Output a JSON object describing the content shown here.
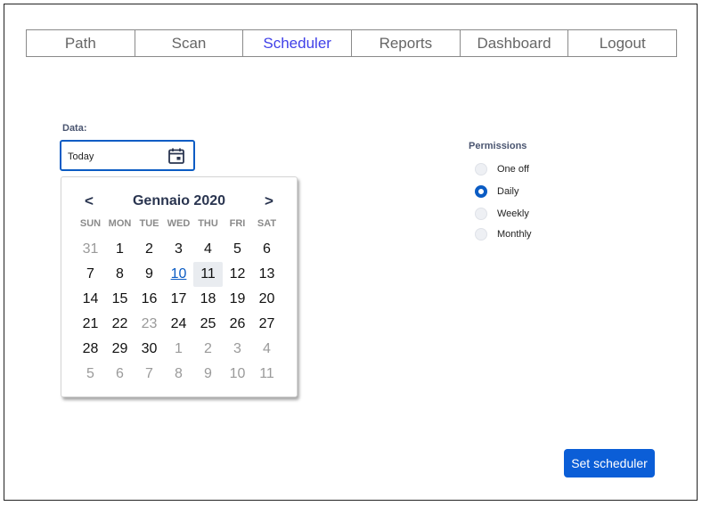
{
  "nav": {
    "items": [
      "Path",
      "Scan",
      "Scheduler",
      "Reports",
      "Dashboard",
      "Logout"
    ],
    "active": "Scheduler"
  },
  "date_field": {
    "label": "Data:",
    "value": "Today",
    "icon": "calendar-icon"
  },
  "calendar": {
    "prev": "<",
    "next": ">",
    "month_title": "Gennaio 2020",
    "weekdays": [
      "SUN",
      "MON",
      "TUE",
      "WED",
      "THU",
      "FRI",
      "SAT"
    ],
    "days": [
      {
        "d": "31",
        "m": true
      },
      {
        "d": "1"
      },
      {
        "d": "2"
      },
      {
        "d": "3"
      },
      {
        "d": "4"
      },
      {
        "d": "5"
      },
      {
        "d": "6"
      },
      {
        "d": "7"
      },
      {
        "d": "8"
      },
      {
        "d": "9"
      },
      {
        "d": "10",
        "today": true
      },
      {
        "d": "11",
        "sel": true
      },
      {
        "d": "12"
      },
      {
        "d": "13"
      },
      {
        "d": "14"
      },
      {
        "d": "15"
      },
      {
        "d": "16"
      },
      {
        "d": "17"
      },
      {
        "d": "18"
      },
      {
        "d": "19"
      },
      {
        "d": "20"
      },
      {
        "d": "21"
      },
      {
        "d": "22"
      },
      {
        "d": "23",
        "m": true
      },
      {
        "d": "24"
      },
      {
        "d": "25"
      },
      {
        "d": "26"
      },
      {
        "d": "27"
      },
      {
        "d": "28"
      },
      {
        "d": "29"
      },
      {
        "d": "30"
      },
      {
        "d": "1",
        "m": true
      },
      {
        "d": "2",
        "m": true
      },
      {
        "d": "3",
        "m": true
      },
      {
        "d": "4",
        "m": true
      },
      {
        "d": "5",
        "m": true
      },
      {
        "d": "6",
        "m": true
      },
      {
        "d": "7",
        "m": true
      },
      {
        "d": "8",
        "m": true
      },
      {
        "d": "9",
        "m": true
      },
      {
        "d": "10",
        "m": true
      },
      {
        "d": "11",
        "m": true
      }
    ]
  },
  "permissions": {
    "label": "Permissions",
    "options": [
      "One off",
      "Daily",
      "Weekly",
      "Monthly"
    ],
    "selected": "Daily"
  },
  "action": {
    "set_label": "Set scheduler"
  },
  "colors": {
    "accent": "#0b5cc4",
    "nav_active": "#4040e8",
    "button_bg": "#0b5ed7"
  }
}
